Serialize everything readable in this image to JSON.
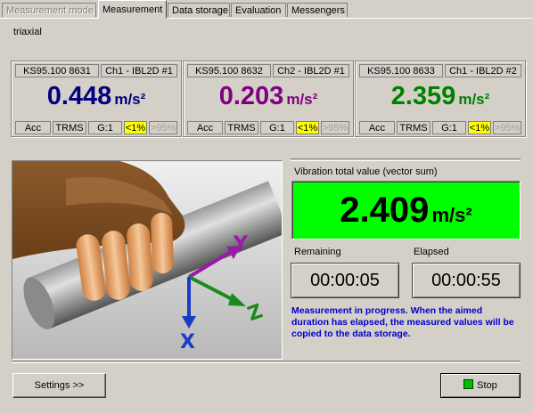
{
  "tabs": [
    {
      "label": "Measurement mode",
      "state": "disabled"
    },
    {
      "label": "Measurement",
      "state": "active"
    },
    {
      "label": "Data storage",
      "state": "normal"
    },
    {
      "label": "Evaluation",
      "state": "normal"
    },
    {
      "label": "Messengers",
      "state": "normal"
    }
  ],
  "mode_label": "triaxial",
  "sensors": [
    {
      "sensor_id": "KS95.100 8631",
      "channel": "Ch1 - IBL2D #1",
      "value": "0.448",
      "unit": "m/s²",
      "color": "#000080",
      "flags": [
        "Acc",
        "TRMS",
        "G:1",
        "<1%",
        ">95%"
      ]
    },
    {
      "sensor_id": "KS95.100 8632",
      "channel": "Ch2 - IBL2D #1",
      "value": "0.203",
      "unit": "m/s²",
      "color": "#800080",
      "flags": [
        "Acc",
        "TRMS",
        "G:1",
        "<1%",
        ">95%"
      ]
    },
    {
      "sensor_id": "KS95.100 8633",
      "channel": "Ch1 - IBL2D #2",
      "value": "2.359",
      "unit": "m/s²",
      "color": "#008000",
      "flags": [
        "Acc",
        "TRMS",
        "G:1",
        "<1%",
        ">95%"
      ]
    }
  ],
  "total": {
    "label": "Vibration total value (vector sum)",
    "value": "2.409",
    "unit": "m/s²",
    "bg_color": "#00ff00"
  },
  "remaining": {
    "label": "Remaining",
    "value": "00:00:05"
  },
  "elapsed": {
    "label": "Elapsed",
    "value": "00:00:55"
  },
  "status_message": "Measurement in progress. When the aimed duration has elapsed, the measured values will be copied to the data storage.",
  "status_color": "#0000cc",
  "axes": {
    "y": "Y",
    "z": "Z",
    "x": "X"
  },
  "buttons": {
    "settings": "Settings >>",
    "stop": "Stop"
  },
  "colors": {
    "highlight_flag": "#ffff00",
    "stop_indicator": "#00c000"
  }
}
